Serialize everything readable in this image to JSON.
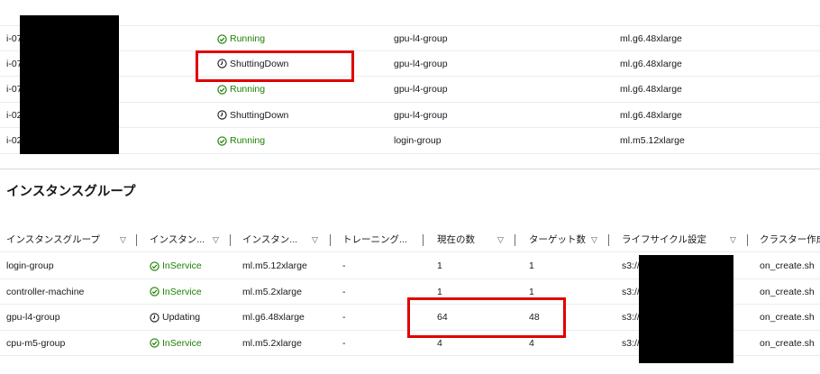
{
  "instances": [
    {
      "id": "i-07",
      "status": "Running",
      "status_kind": "ok",
      "group": "gpu-l4-group",
      "type": "ml.g6.48xlarge"
    },
    {
      "id": "i-07",
      "status": "ShuttingDown",
      "status_kind": "neutral",
      "group": "gpu-l4-group",
      "type": "ml.g6.48xlarge"
    },
    {
      "id": "i-07",
      "status": "Running",
      "status_kind": "ok",
      "group": "gpu-l4-group",
      "type": "ml.g6.48xlarge"
    },
    {
      "id": "i-02",
      "status": "ShuttingDown",
      "status_kind": "neutral",
      "group": "gpu-l4-group",
      "type": "ml.g6.48xlarge"
    },
    {
      "id": "i-02",
      "status": "Running",
      "status_kind": "ok",
      "group": "login-group",
      "type": "ml.m5.12xlarge"
    }
  ],
  "section_title": "インスタンスグループ",
  "group_table": {
    "headers": {
      "name": "インスタンスグループ",
      "status": "インスタン...",
      "type": "インスタン...",
      "training": "トレーニング...",
      "current": "現在の数",
      "target": "ターゲット数",
      "lifecycle": "ライフサイクル設定",
      "created": "クラスター作成"
    },
    "rows": [
      {
        "name": "login-group",
        "status": "InService",
        "status_kind": "ok",
        "type": "ml.m5.12xlarge",
        "training": "-",
        "current": "1",
        "target": "1",
        "lifecycle": "s3://",
        "created": "on_create.sh"
      },
      {
        "name": "controller-machine",
        "status": "InService",
        "status_kind": "ok",
        "type": "ml.m5.2xlarge",
        "training": "-",
        "current": "1",
        "target": "1",
        "lifecycle": "s3://",
        "created": "on_create.sh"
      },
      {
        "name": "gpu-l4-group",
        "status": "Updating",
        "status_kind": "neutral",
        "type": "ml.g6.48xlarge",
        "training": "-",
        "current": "64",
        "target": "48",
        "lifecycle": "s3://",
        "created": "on_create.sh"
      },
      {
        "name": "cpu-m5-group",
        "status": "InService",
        "status_kind": "ok",
        "type": "ml.m5.2xlarge",
        "training": "-",
        "current": "4",
        "target": "4",
        "lifecycle": "s3://",
        "created": "on_create.sh"
      }
    ]
  },
  "colors": {
    "success": "#1d8102",
    "highlight": "#e00000",
    "redaction": "#000000"
  },
  "icons": {
    "ok": "check-circle-icon",
    "neutral": "clock-icon",
    "sort": "caret-down-icon"
  }
}
